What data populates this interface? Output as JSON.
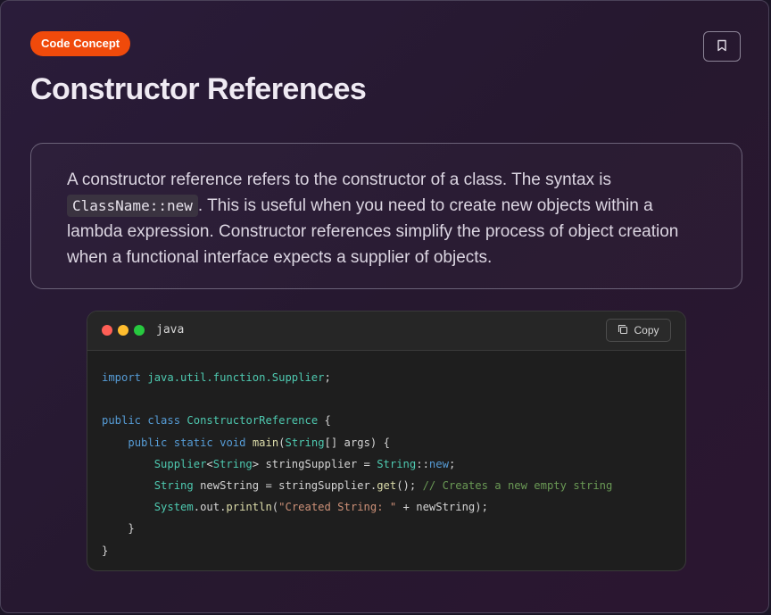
{
  "badge": "Code Concept",
  "title": "Constructor References",
  "description": {
    "before": "A constructor reference refers to the constructor of a class. The syntax is ",
    "code": "ClassName::new",
    "after": ". This is useful when you need to create new objects within a lambda expression. Constructor references simplify the process of object creation when a functional interface expects a supplier of objects."
  },
  "code_block": {
    "language": "java",
    "copy_label": "Copy",
    "tokens": {
      "import_kw": "import",
      "import_path": "java.util.function.Supplier",
      "import_end": ";",
      "public1": "public",
      "class_kw": "class",
      "class_name": "ConstructorReference",
      "open1": " {",
      "public2": "public",
      "static_kw": "static",
      "void_kw": "void",
      "main_fn": "main",
      "paren_open": "(",
      "string_arr": "String",
      "args_part": "[] args) {",
      "supplier_ty": "Supplier",
      "lt": "<",
      "string_generic": "String",
      "supplier_var": "> stringSupplier = ",
      "string_ref": "String",
      "ref_op": "::",
      "new_kw": "new",
      "semi1": ";",
      "string_decl": "String",
      "newstring_decl": " newString = stringSupplier.",
      "get_fn": "get",
      "get_end": "(); ",
      "comment": "// Creates a new empty string",
      "system_ty": "System",
      "out_part": ".out.",
      "println_fn": "println",
      "println_open": "(",
      "str_lit": "\"Created String: \"",
      "println_rest": " + newString);",
      "close_inner": "}",
      "close_outer": "}"
    }
  },
  "colors": {
    "badge_bg": "#f04a0b",
    "dot_red": "#ff5f56",
    "dot_yellow": "#ffbd2e",
    "dot_green": "#27c93f"
  },
  "icons": {
    "bookmark": "bookmark-icon",
    "copy": "copy-icon"
  }
}
